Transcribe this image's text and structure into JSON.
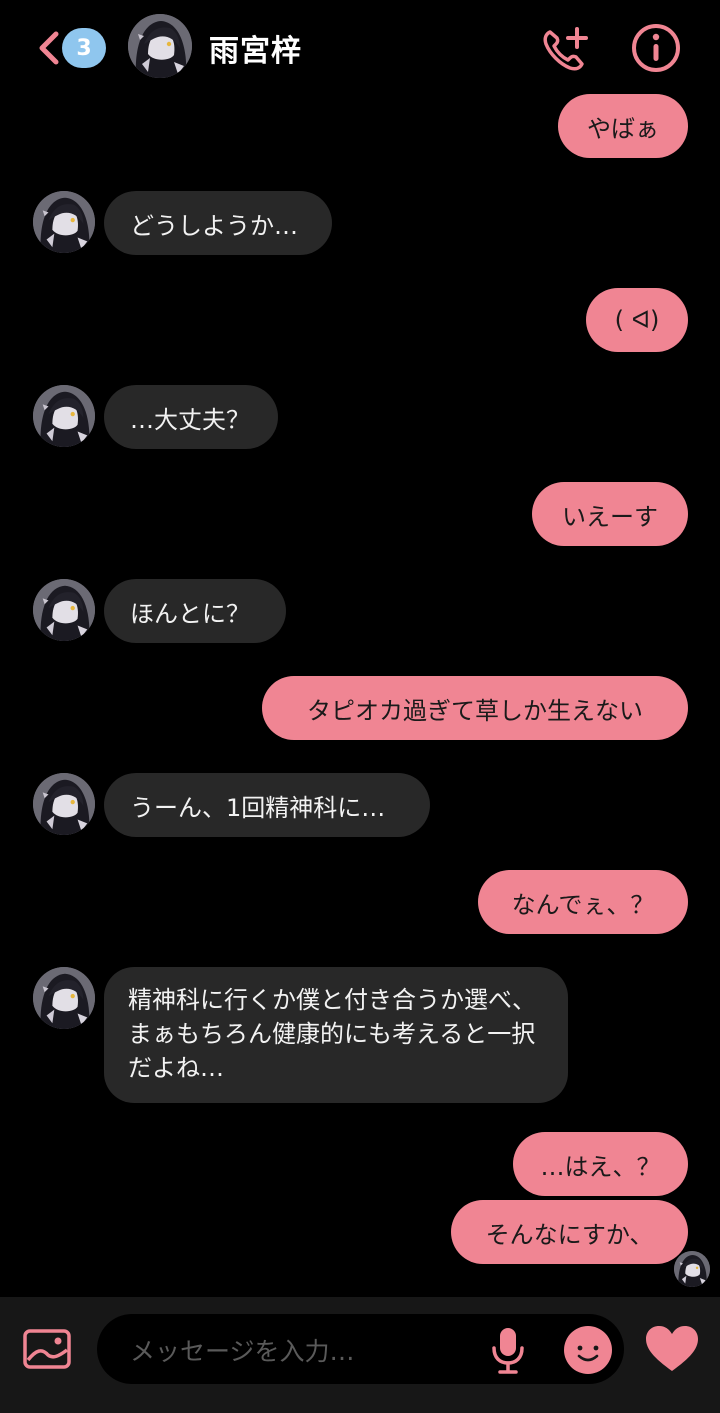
{
  "header": {
    "unread_count": "3",
    "contact_name": "雨宮梓",
    "icons": {
      "back": "chevron-left-icon",
      "call": "phone-add-icon",
      "info": "info-icon"
    },
    "accent_color": "#f08593",
    "badge_color": "#8fc6ee"
  },
  "messages": [
    {
      "sender": "me",
      "text": "やばぁ"
    },
    {
      "sender": "them",
      "text": "どうしようか…"
    },
    {
      "sender": "me",
      "text": "( ᐊ)"
    },
    {
      "sender": "them",
      "text": "…大丈夫？"
    },
    {
      "sender": "me",
      "text": "いえーす"
    },
    {
      "sender": "them",
      "text": "ほんとに？"
    },
    {
      "sender": "me",
      "text": "タピオカ過ぎて草しか生えない"
    },
    {
      "sender": "them",
      "text": "うーん、1回精神科に…"
    },
    {
      "sender": "me",
      "text": "なんでぇ、？"
    },
    {
      "sender": "them",
      "text": "精神科に行くか僕と付き合うか選べ、まぁもちろん健康的にも考えると一択だよね…"
    },
    {
      "sender": "me",
      "text": "…はえ、？"
    },
    {
      "sender": "me",
      "text": "そんなにすか、"
    }
  ],
  "composer": {
    "placeholder": "メッセージを入力…",
    "icons": {
      "image": "image-icon",
      "mic": "microphone-icon",
      "emoji": "emoji-icon",
      "like": "heart-icon"
    }
  },
  "colors": {
    "outgoing_bubble": "#f08593",
    "incoming_bubble": "#282828",
    "background": "#000000"
  }
}
